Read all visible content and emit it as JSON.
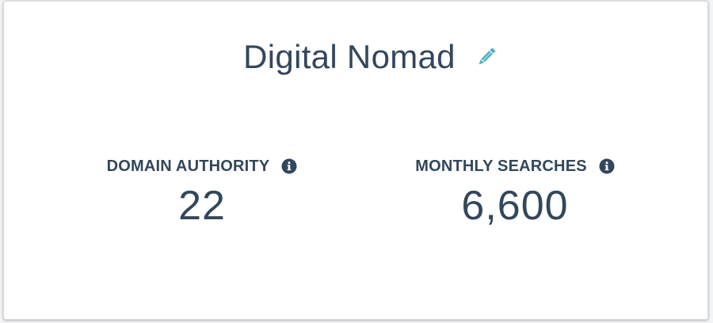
{
  "header": {
    "title": "Digital Nomad",
    "edit_icon": "pencil-icon"
  },
  "metrics": [
    {
      "label": "DOMAIN AUTHORITY",
      "value": "22",
      "icon": "info-icon"
    },
    {
      "label": "MONTHLY SEARCHES",
      "value": "6,600",
      "icon": "info-icon"
    }
  ],
  "colors": {
    "text": "#33475b",
    "accent": "#4fb0c6",
    "background": "#ffffff"
  }
}
